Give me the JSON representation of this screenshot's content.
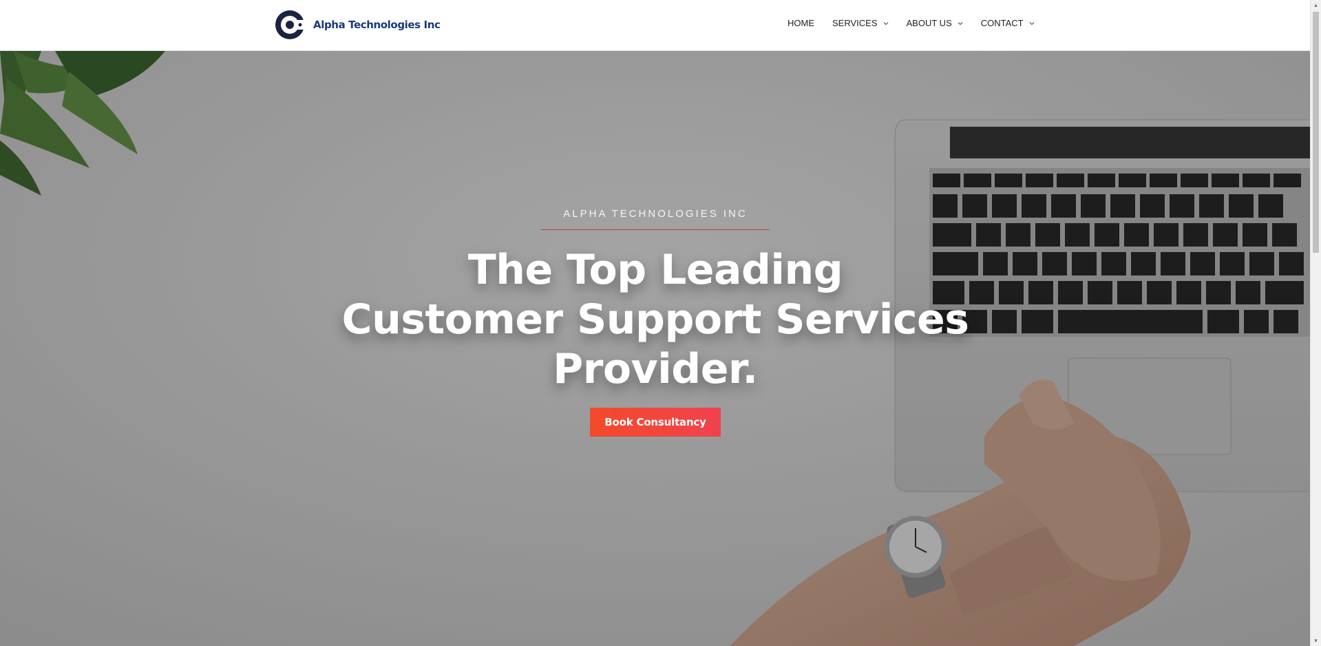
{
  "brand": {
    "name": "Alpha Technologies Inc",
    "color": "#1b3a7a"
  },
  "nav": {
    "items": [
      {
        "label": "HOME",
        "has_dropdown": false
      },
      {
        "label": "SERVICES",
        "has_dropdown": true
      },
      {
        "label": "ABOUT US",
        "has_dropdown": true
      },
      {
        "label": "CONTACT",
        "has_dropdown": true
      }
    ]
  },
  "hero": {
    "eyebrow": "ALPHA TECHNOLOGIES INC",
    "headline": [
      "The Top Leading",
      "Customer Support Services",
      "Provider."
    ],
    "cta_label": "Book Consultancy",
    "cta_color": "#f34a2a",
    "divider_color": "#c83a3a"
  }
}
